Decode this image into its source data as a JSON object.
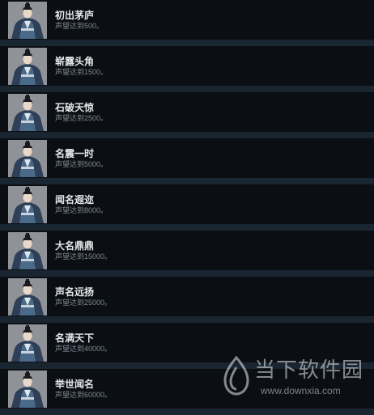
{
  "achievements": [
    {
      "title": "初出茅庐",
      "desc": "声望达到500。"
    },
    {
      "title": "崭露头角",
      "desc": "声望达到1500。"
    },
    {
      "title": "石破天惊",
      "desc": "声望达到2500。"
    },
    {
      "title": "名震一时",
      "desc": "声望达到5000。"
    },
    {
      "title": "闻名遐迩",
      "desc": "声望达到8000。"
    },
    {
      "title": "大名鼎鼎",
      "desc": "声望达到15000。"
    },
    {
      "title": "声名远扬",
      "desc": "声望达到25000。"
    },
    {
      "title": "名满天下",
      "desc": "声望达到40000。"
    },
    {
      "title": "举世闻名",
      "desc": "声望达到60000。"
    }
  ],
  "watermark": {
    "name": "当下软件园",
    "url": "www.downxia.com"
  },
  "icons": {
    "thumbnail": "scholar-portrait-icon",
    "watermark_logo": "downxia-logo-icon"
  },
  "colors": {
    "row_bg": "#0b0f14",
    "separator": "#1a2532",
    "title": "#e4e6e8",
    "desc": "#7f8891"
  }
}
